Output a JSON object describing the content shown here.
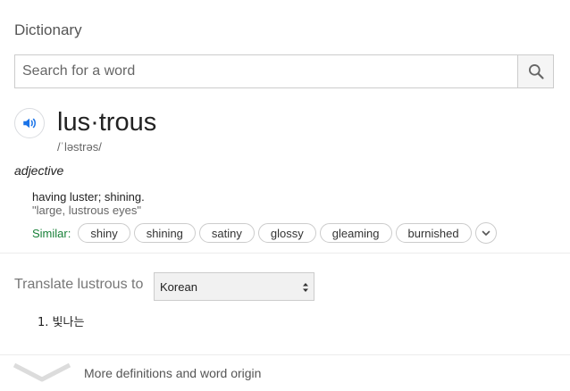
{
  "header": {
    "title": "Dictionary"
  },
  "search": {
    "placeholder": "Search for a word",
    "value": ""
  },
  "entry": {
    "word": "lus·trous",
    "phonetic": "/ˈləstrəs/",
    "part_of_speech": "adjective",
    "definition": "having luster; shining.",
    "example": "\"large, lustrous eyes\"",
    "similar_label": "Similar:",
    "similar": [
      "shiny",
      "shining",
      "satiny",
      "glossy",
      "gleaming",
      "burnished"
    ]
  },
  "translate": {
    "label": "Translate lustrous to",
    "selected_language": "Korean",
    "result_number": "1.",
    "result_text": "빛나는"
  },
  "footer": {
    "more_label": "More definitions and word origin"
  },
  "colors": {
    "accent_blue": "#1a73e8",
    "similar_green": "#188038"
  },
  "icons": {
    "search": "search-icon",
    "speaker": "speaker-icon",
    "expand": "chevron-down-icon"
  }
}
